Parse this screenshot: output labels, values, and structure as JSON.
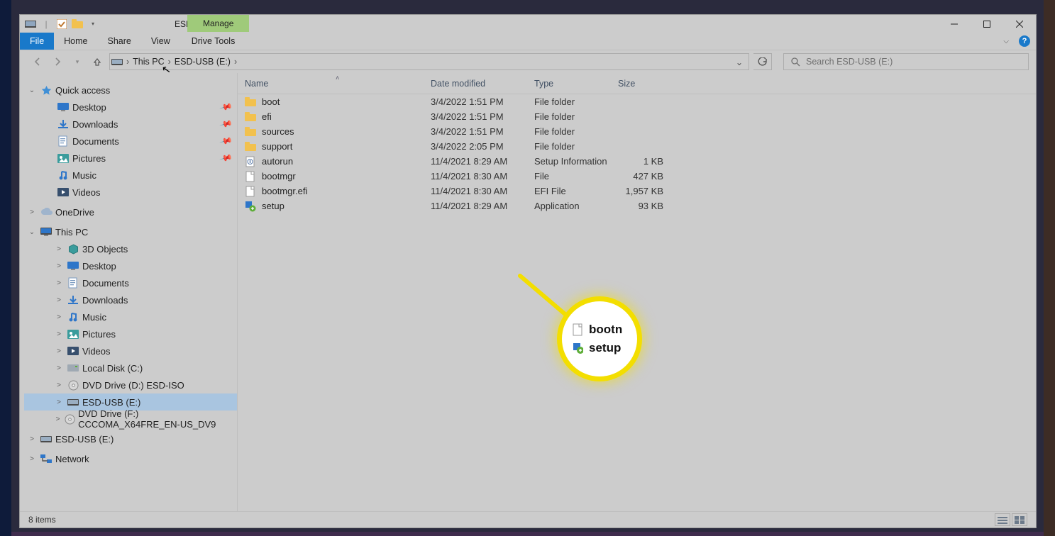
{
  "window_title": "ESD-USB (E:)",
  "ctx_group_label": "Manage",
  "ribbon_tabs": {
    "file": "File",
    "home": "Home",
    "share": "Share",
    "view": "View",
    "drive_tools": "Drive Tools"
  },
  "breadcrumb": {
    "root": "This PC",
    "leaf": "ESD-USB (E:)"
  },
  "search_placeholder": "Search ESD-USB (E:)",
  "columns": {
    "name": "Name",
    "date": "Date modified",
    "type": "Type",
    "size": "Size"
  },
  "files": [
    {
      "icon": "folder",
      "name": "boot",
      "date": "3/4/2022 1:51 PM",
      "type": "File folder",
      "size": ""
    },
    {
      "icon": "folder",
      "name": "efi",
      "date": "3/4/2022 1:51 PM",
      "type": "File folder",
      "size": ""
    },
    {
      "icon": "folder",
      "name": "sources",
      "date": "3/4/2022 1:51 PM",
      "type": "File folder",
      "size": ""
    },
    {
      "icon": "folder",
      "name": "support",
      "date": "3/4/2022 2:05 PM",
      "type": "File folder",
      "size": ""
    },
    {
      "icon": "inf",
      "name": "autorun",
      "date": "11/4/2021 8:29 AM",
      "type": "Setup Information",
      "size": "1 KB"
    },
    {
      "icon": "file",
      "name": "bootmgr",
      "date": "11/4/2021 8:30 AM",
      "type": "File",
      "size": "427 KB"
    },
    {
      "icon": "file",
      "name": "bootmgr.efi",
      "date": "11/4/2021 8:30 AM",
      "type": "EFI File",
      "size": "1,957 KB"
    },
    {
      "icon": "setup",
      "name": "setup",
      "date": "11/4/2021 8:29 AM",
      "type": "Application",
      "size": "93 KB"
    }
  ],
  "navtree": {
    "quick_access": "Quick access",
    "qa_items": [
      {
        "label": "Desktop",
        "icon": "desktop",
        "pinned": true
      },
      {
        "label": "Downloads",
        "icon": "download",
        "pinned": true
      },
      {
        "label": "Documents",
        "icon": "docs",
        "pinned": true
      },
      {
        "label": "Pictures",
        "icon": "pics",
        "pinned": true
      },
      {
        "label": "Music",
        "icon": "music",
        "pinned": false
      },
      {
        "label": "Videos",
        "icon": "video",
        "pinned": false
      }
    ],
    "onedrive": "OneDrive",
    "this_pc": "This PC",
    "pc_items": [
      {
        "label": "3D Objects",
        "icon": "obj3d"
      },
      {
        "label": "Desktop",
        "icon": "desktop"
      },
      {
        "label": "Documents",
        "icon": "docs"
      },
      {
        "label": "Downloads",
        "icon": "download"
      },
      {
        "label": "Music",
        "icon": "music"
      },
      {
        "label": "Pictures",
        "icon": "pics"
      },
      {
        "label": "Videos",
        "icon": "video"
      },
      {
        "label": "Local Disk (C:)",
        "icon": "disk"
      },
      {
        "label": "DVD Drive (D:) ESD-ISO",
        "icon": "dvd"
      },
      {
        "label": "ESD-USB (E:)",
        "icon": "usb",
        "selected": true
      },
      {
        "label": "DVD Drive (F:) CCCOMA_X64FRE_EN-US_DV9",
        "icon": "dvd"
      }
    ],
    "esd_usb_root": "ESD-USB (E:)",
    "network": "Network"
  },
  "status_text": "8 items",
  "callout": {
    "line1": "bootn",
    "line2": "setup"
  }
}
